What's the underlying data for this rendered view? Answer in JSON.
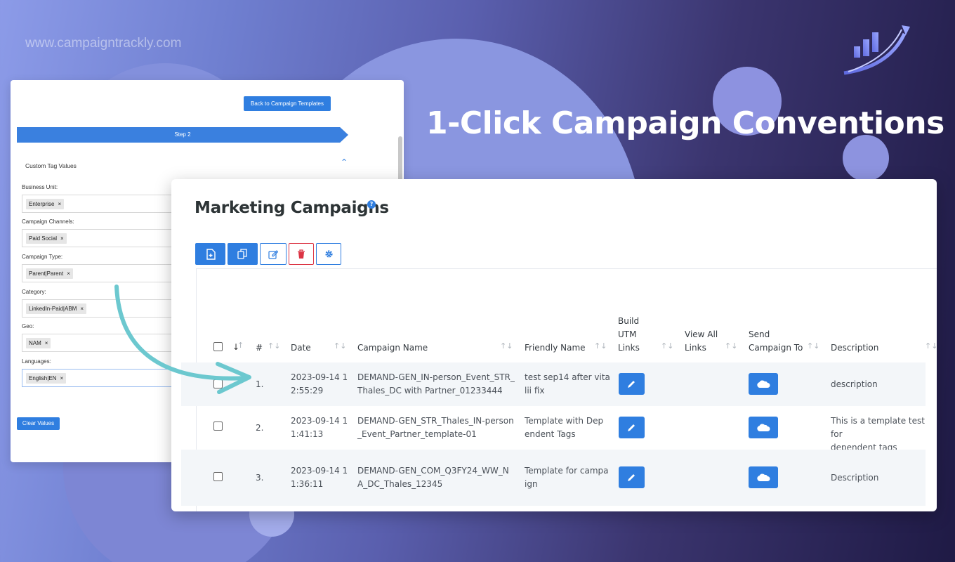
{
  "watermark": "www.campaigntrackly.com",
  "headline": "1-Click Campaign Conventions",
  "colors": {
    "accent": "#2f7ee0",
    "teal_arrow": "#6cc8cf",
    "danger": "#dc3545"
  },
  "back_panel": {
    "back_button": "Back to Campaign Templates",
    "step": "Step 2",
    "section_title": "Custom Tag Values",
    "fields": [
      {
        "label": "Business Unit:",
        "value": "Enterprise"
      },
      {
        "label": "Campaign Channels:",
        "value": "Paid Social"
      },
      {
        "label": "Campaign Type:",
        "value": "Parent|Parent"
      },
      {
        "label": "Category:",
        "value": "LinkedIn-Paid|ABM"
      },
      {
        "label": "Geo:",
        "value": "NAM"
      },
      {
        "label": "Languages:",
        "value": "English|EN"
      }
    ],
    "clear_button": "Clear Values"
  },
  "main": {
    "title": "Marketing Campaigns",
    "help": "?",
    "toolbar": [
      "new-file-icon",
      "copy-icon",
      "edit-icon",
      "trash-icon",
      "gear-icon"
    ],
    "columns": {
      "num": "#",
      "date": "Date",
      "campaign": "Campaign Name",
      "friendly": "Friendly Name",
      "build_1": "Build",
      "build_2": "UTM",
      "build_3": "Links",
      "view_1": "View All",
      "view_2": "Links",
      "send_1": "Send",
      "send_2": "Campaign To",
      "desc": "Description"
    },
    "rows": [
      {
        "num": "1.",
        "date_1": "2023-09-14 1",
        "date_2": "2:55:29",
        "campaign_1": "DEMAND-GEN_IN-person_Event_STR_",
        "campaign_2": "Thales_DC with Partner_01233444",
        "friendly_1": "test sep14 after vita",
        "friendly_2": "lii fix",
        "desc_1": "description",
        "desc_2": ""
      },
      {
        "num": "2.",
        "date_1": "2023-09-14 1",
        "date_2": "1:41:13",
        "campaign_1": "DEMAND-GEN_STR_Thales_IN-person",
        "campaign_2": "_Event_Partner_template-01",
        "friendly_1": "Template with Dep",
        "friendly_2": "endent Tags",
        "desc_1": "This is a template test for",
        "desc_2": "dependent tags"
      },
      {
        "num": "3.",
        "date_1": "2023-09-14 1",
        "date_2": "1:36:11",
        "campaign_1": "DEMAND-GEN_COM_Q3FY24_WW_N",
        "campaign_2": "A_DC_Thales_12345",
        "friendly_1": "Template for campa",
        "friendly_2": "ign",
        "desc_1": "Description",
        "desc_2": ""
      }
    ]
  }
}
